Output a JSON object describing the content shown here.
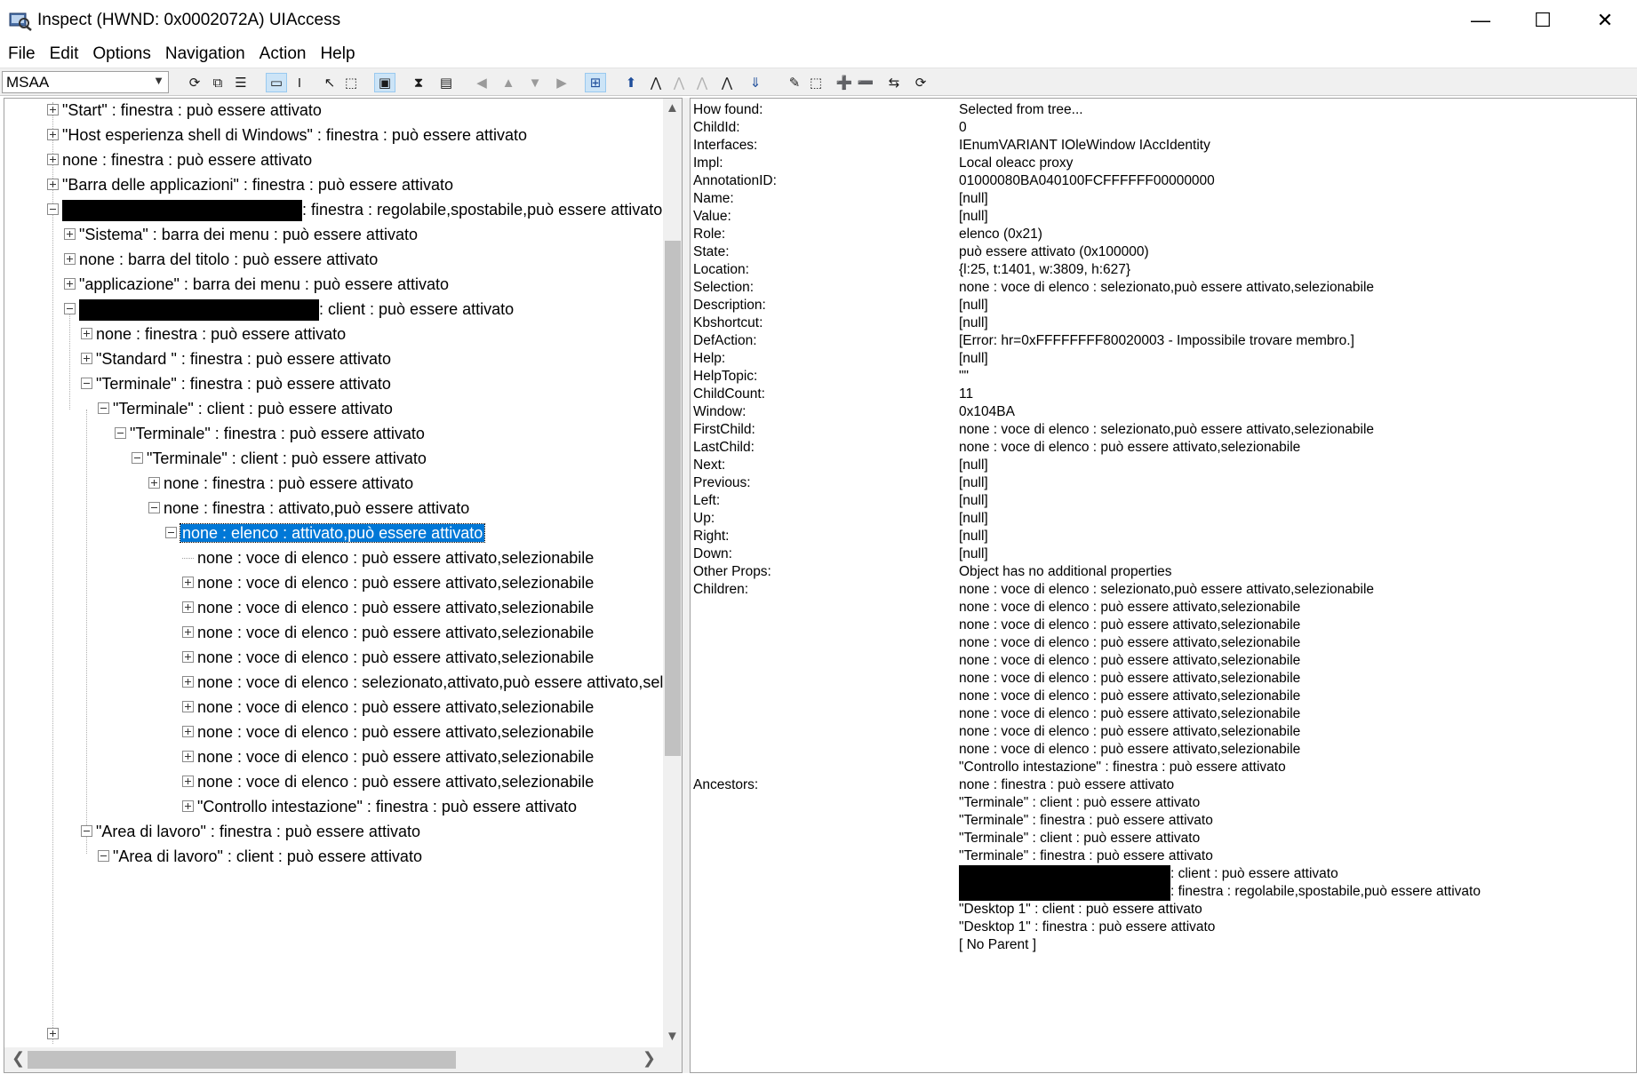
{
  "window": {
    "title": "Inspect  (HWND: 0x0002072A) UIAccess",
    "min_glyph": "—",
    "max_glyph": "☐",
    "close_glyph": "✕"
  },
  "menu": [
    "File",
    "Edit",
    "Options",
    "Navigation",
    "Action",
    "Help"
  ],
  "toolbar": {
    "mode": "MSAA",
    "icons": [
      "refresh-icon",
      "copy-icon",
      "options-icon",
      "watch-focus-icon",
      "watch-caret-icon",
      "watch-cursor-icon",
      "watch-tooltip-icon",
      "highlight-rect-icon",
      "show-info-tooltip-icon",
      "show-info-tooltip-2-icon",
      "nav-back-icon",
      "nav-up-icon",
      "nav-down-icon",
      "nav-forward-icon",
      "tree-view-icon",
      "parent-icon",
      "first-child-icon",
      "prev-sibling-icon",
      "next-sibling-icon",
      "last-child-icon",
      "navigate-icon",
      "do-default-action-icon",
      "select-icon",
      "select-add-icon",
      "select-remove-icon",
      "select-extend-icon",
      "refresh-list-icon"
    ]
  },
  "tree": [
    {
      "level": 0,
      "expander": "plus",
      "text": "\"Start\" : finestra : può essere attivato"
    },
    {
      "level": 0,
      "expander": "plus",
      "text": "\"Host esperienza shell di Windows\" : finestra : può essere attivato"
    },
    {
      "level": 0,
      "expander": "plus",
      "text": "none : finestra : può essere attivato"
    },
    {
      "level": 0,
      "expander": "plus",
      "text": "\"Barra delle applicazioni\" : finestra : può essere attivato"
    },
    {
      "level": 0,
      "expander": "minus",
      "redact": 270,
      "text": ": finestra : regolabile,spostabile,può essere attivato"
    },
    {
      "level": 1,
      "expander": "plus",
      "text": "\"Sistema\" : barra dei menu : può essere attivato"
    },
    {
      "level": 1,
      "expander": "plus",
      "text": "none : barra del titolo : può essere attivato"
    },
    {
      "level": 1,
      "expander": "plus",
      "text": "\"applicazione\" : barra dei menu : può essere attivato"
    },
    {
      "level": 1,
      "expander": "minus",
      "redact": 270,
      "text": ": client : può essere attivato"
    },
    {
      "level": 2,
      "expander": "plus",
      "text": "none : finestra : può essere attivato"
    },
    {
      "level": 2,
      "expander": "plus",
      "text": "\"Standard \" : finestra : può essere attivato"
    },
    {
      "level": 2,
      "expander": "minus",
      "text": "\"Terminale\" : finestra : può essere attivato"
    },
    {
      "level": 3,
      "expander": "minus",
      "text": "\"Terminale\" : client : può essere attivato"
    },
    {
      "level": 4,
      "expander": "minus",
      "text": "\"Terminale\" : finestra : può essere attivato"
    },
    {
      "level": 5,
      "expander": "minus",
      "text": "\"Terminale\" : client : può essere attivato"
    },
    {
      "level": 6,
      "expander": "plus",
      "text": "none : finestra : può essere attivato"
    },
    {
      "level": 6,
      "expander": "minus",
      "text": "none : finestra : attivato,può essere attivato"
    },
    {
      "level": 7,
      "expander": "minus",
      "selected": true,
      "text": "none : elenco : attivato,può essere attivato"
    },
    {
      "level": 8,
      "expander": "leaf",
      "text": "none : voce di elenco : può essere attivato,selezionabile"
    },
    {
      "level": 8,
      "expander": "plus",
      "text": "none : voce di elenco : può essere attivato,selezionabile"
    },
    {
      "level": 8,
      "expander": "plus",
      "text": "none : voce di elenco : può essere attivato,selezionabile"
    },
    {
      "level": 8,
      "expander": "plus",
      "text": "none : voce di elenco : può essere attivato,selezionabile"
    },
    {
      "level": 8,
      "expander": "plus",
      "text": "none : voce di elenco : può essere attivato,selezionabile"
    },
    {
      "level": 8,
      "expander": "plus",
      "text": "none : voce di elenco : selezionato,attivato,può essere attivato,selezionabile"
    },
    {
      "level": 8,
      "expander": "plus",
      "text": "none : voce di elenco : può essere attivato,selezionabile"
    },
    {
      "level": 8,
      "expander": "plus",
      "text": "none : voce di elenco : può essere attivato,selezionabile"
    },
    {
      "level": 8,
      "expander": "plus",
      "text": "none : voce di elenco : può essere attivato,selezionabile"
    },
    {
      "level": 8,
      "expander": "plus",
      "text": "none : voce di elenco : può essere attivato,selezionabile"
    },
    {
      "level": 8,
      "expander": "plus",
      "text": "\"Controllo intestazione\" : finestra : può essere attivato"
    },
    {
      "level": 2,
      "expander": "minus",
      "text": "\"Area di lavoro\" : finestra : può essere attivato"
    },
    {
      "level": 3,
      "expander": "minus",
      "text": "\"Area di lavoro\" : client : può essere attivato"
    }
  ],
  "properties": [
    {
      "key": "How found:",
      "values": [
        "Selected from tree..."
      ]
    },
    {
      "key": "ChildId:",
      "values": [
        "0"
      ]
    },
    {
      "key": "Interfaces:",
      "values": [
        "IEnumVARIANT IOleWindow IAccIdentity"
      ]
    },
    {
      "key": "Impl:",
      "values": [
        "Local oleacc proxy"
      ]
    },
    {
      "key": "AnnotationID:",
      "values": [
        "01000080BA040100FCFFFFFF00000000"
      ]
    },
    {
      "key": "Name:",
      "values": [
        "[null]"
      ]
    },
    {
      "key": "Value:",
      "values": [
        "[null]"
      ]
    },
    {
      "key": "Role:",
      "values": [
        "elenco (0x21)"
      ]
    },
    {
      "key": "State:",
      "values": [
        "può essere attivato (0x100000)"
      ]
    },
    {
      "key": "Location:",
      "values": [
        "{l:25, t:1401, w:3809, h:627}"
      ]
    },
    {
      "key": "Selection:",
      "values": [
        "none : voce di elenco : selezionato,può essere attivato,selezionabile"
      ]
    },
    {
      "key": "Description:",
      "values": [
        "[null]"
      ]
    },
    {
      "key": "Kbshortcut:",
      "values": [
        "[null]"
      ]
    },
    {
      "key": "DefAction:",
      "values": [
        "[Error: hr=0xFFFFFFFF80020003 - Impossibile trovare membro.]"
      ]
    },
    {
      "key": "Help:",
      "values": [
        "[null]"
      ]
    },
    {
      "key": "HelpTopic:",
      "values": [
        "\"\""
      ]
    },
    {
      "key": "ChildCount:",
      "values": [
        "11"
      ]
    },
    {
      "key": "Window:",
      "values": [
        "0x104BA"
      ]
    },
    {
      "key": "FirstChild:",
      "values": [
        "none : voce di elenco : selezionato,può essere attivato,selezionabile"
      ]
    },
    {
      "key": "LastChild:",
      "values": [
        "none : voce di elenco : può essere attivato,selezionabile"
      ]
    },
    {
      "key": "Next:",
      "values": [
        "[null]"
      ]
    },
    {
      "key": "Previous:",
      "values": [
        "[null]"
      ]
    },
    {
      "key": "Left:",
      "values": [
        "[null]"
      ]
    },
    {
      "key": "Up:",
      "values": [
        "[null]"
      ]
    },
    {
      "key": "Right:",
      "values": [
        "[null]"
      ]
    },
    {
      "key": "Down:",
      "values": [
        "[null]"
      ]
    },
    {
      "key": "Other Props:",
      "values": [
        "Object has no additional properties"
      ]
    },
    {
      "key": "Children:",
      "values": [
        "none : voce di elenco : selezionato,può essere attivato,selezionabile",
        "none : voce di elenco : può essere attivato,selezionabile",
        "none : voce di elenco : può essere attivato,selezionabile",
        "none : voce di elenco : può essere attivato,selezionabile",
        "none : voce di elenco : può essere attivato,selezionabile",
        "none : voce di elenco : può essere attivato,selezionabile",
        "none : voce di elenco : può essere attivato,selezionabile",
        "none : voce di elenco : può essere attivato,selezionabile",
        "none : voce di elenco : può essere attivato,selezionabile",
        "none : voce di elenco : può essere attivato,selezionabile",
        "\"Controllo intestazione\" : finestra : può essere attivato"
      ]
    },
    {
      "key": "Ancestors:",
      "values": [
        "none : finestra : può essere attivato",
        "\"Terminale\" : client : può essere attivato",
        "\"Terminale\" : finestra : può essere attivato",
        "\"Terminale\" : client : può essere attivato",
        "\"Terminale\" : finestra : può essere attivato",
        "~: client : può essere attivato",
        "~: finestra : regolabile,spostabile,può essere attivato",
        "\"Desktop 1\" : client : può essere attivato",
        "\"Desktop 1\" : finestra : può essere attivato",
        "[ No Parent ]"
      ]
    }
  ],
  "colors": {
    "selection": "#0078d7",
    "toolbar_bg": "#f0f0f0"
  }
}
